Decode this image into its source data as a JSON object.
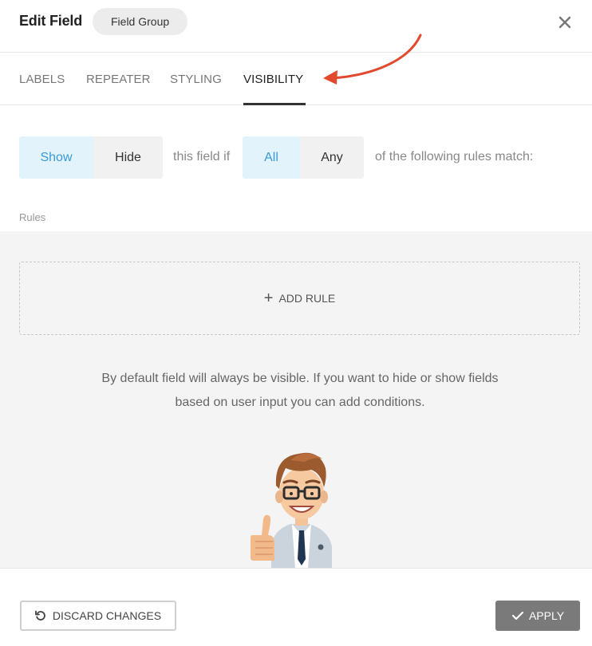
{
  "header": {
    "title": "Edit Field",
    "pill_label": "Field Group",
    "close_icon": "close-icon"
  },
  "tabs": [
    {
      "label": "LABELS",
      "active": false
    },
    {
      "label": "REPEATER",
      "active": false
    },
    {
      "label": "STYLING",
      "active": false
    },
    {
      "label": "VISIBILITY",
      "active": true
    }
  ],
  "visibility": {
    "show_label": "Show",
    "hide_label": "Hide",
    "mode_selected": "Show",
    "connector_text": "this field if",
    "all_label": "All",
    "any_label": "Any",
    "match_selected": "All",
    "suffix_text": "of the following rules match:"
  },
  "rules": {
    "label": "Rules",
    "add_rule_label": "ADD RULE",
    "hint_line1": "By default field will always be visible. If you want to hide or show fields",
    "hint_line2": "based on user input you can add conditions."
  },
  "footer": {
    "discard_label": "DISCARD CHANGES",
    "apply_label": "APPLY"
  },
  "colors": {
    "accent": "#3a9ad9",
    "selected_bg": "#e3f3fc",
    "annotation_arrow": "#e24a2f",
    "apply_bg": "#7a7a7a"
  }
}
